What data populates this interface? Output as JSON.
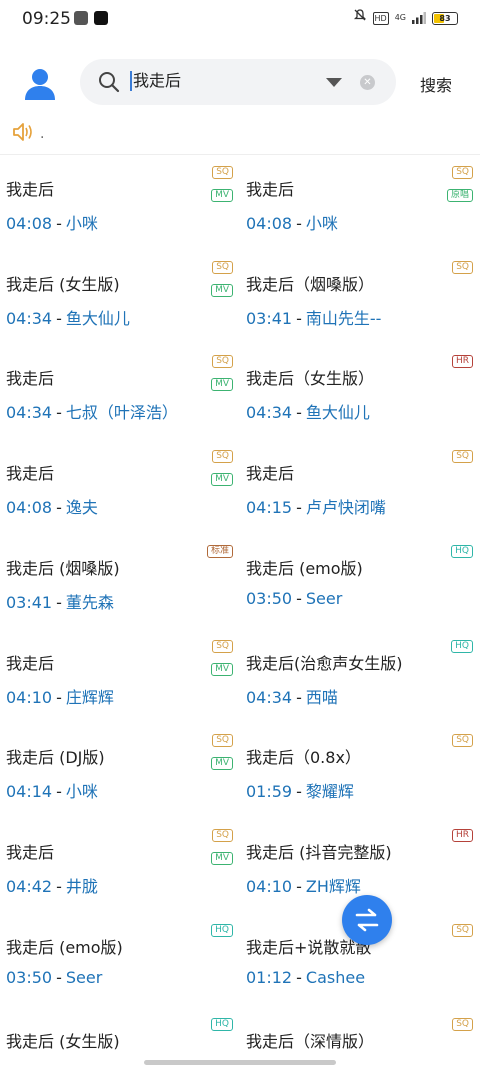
{
  "status_bar": {
    "time": "09:25",
    "network": "4G",
    "hd": "HD",
    "battery": "83"
  },
  "search": {
    "query": "我走后",
    "button_label": "搜索"
  },
  "announcement": {
    "text": "."
  },
  "colors": {
    "accent": "#2f80ed",
    "link": "#1f73b7",
    "badge_sq": "#d4a14a",
    "badge_mv": "#3cb371",
    "badge_hq": "#2fb6a8",
    "badge_hr": "#b5423a",
    "badge_std": "#b06a3a"
  },
  "songs": [
    {
      "title": "我走后",
      "time": "04:08",
      "artist": "小咪",
      "badges": [
        "SQ",
        "MV"
      ]
    },
    {
      "title": "我走后",
      "time": "04:08",
      "artist": "小咪",
      "badges": [
        "SQ",
        "原唱"
      ]
    },
    {
      "title": "我走后 (女生版)",
      "time": "04:34",
      "artist": "鱼大仙儿",
      "badges": [
        "SQ",
        "MV"
      ]
    },
    {
      "title": "我走后（烟嗓版）",
      "time": "03:41",
      "artist": "南山先生--",
      "badges": [
        "SQ"
      ]
    },
    {
      "title": "我走后",
      "time": "04:34",
      "artist": "七叔（叶泽浩）",
      "badges": [
        "SQ",
        "MV"
      ]
    },
    {
      "title": "我走后（女生版）",
      "time": "04:34",
      "artist": "鱼大仙儿",
      "badges": [
        "HR"
      ]
    },
    {
      "title": "我走后",
      "time": "04:08",
      "artist": "逸夫",
      "badges": [
        "SQ",
        "MV"
      ]
    },
    {
      "title": "我走后",
      "time": "04:15",
      "artist": "卢卢快闭嘴",
      "badges": [
        "SQ"
      ]
    },
    {
      "title": "我走后 (烟嗓版)",
      "time": "03:41",
      "artist": "董先森",
      "badges": [
        "标准"
      ]
    },
    {
      "title": "我走后 (emo版)",
      "time": "03:50",
      "artist": "Seer",
      "badges": [
        "HQ"
      ]
    },
    {
      "title": "我走后",
      "time": "04:10",
      "artist": "庄辉辉",
      "badges": [
        "SQ",
        "MV"
      ]
    },
    {
      "title": "我走后(治愈声女生版)",
      "time": "04:34",
      "artist": "西喵",
      "badges": [
        "HQ"
      ]
    },
    {
      "title": "我走后 (DJ版)",
      "time": "04:14",
      "artist": "小咪",
      "badges": [
        "SQ",
        "MV"
      ]
    },
    {
      "title": "我走后（0.8x）",
      "time": "01:59",
      "artist": "黎耀辉",
      "badges": [
        "SQ"
      ]
    },
    {
      "title": "我走后",
      "time": "04:42",
      "artist": "井胧",
      "badges": [
        "SQ",
        "MV"
      ]
    },
    {
      "title": "我走后 (抖音完整版)",
      "time": "04:10",
      "artist": "ZH辉辉",
      "badges": [
        "HR"
      ]
    },
    {
      "title": "我走后 (emo版)",
      "time": "03:50",
      "artist": "Seer",
      "badges": [
        "HQ"
      ]
    },
    {
      "title": "我走后+说散就散",
      "time": "01:12",
      "artist": "Cashee",
      "badges": [
        "SQ"
      ]
    },
    {
      "title": "我走后 (女生版)",
      "time": "",
      "artist": "",
      "badges": [
        "HQ"
      ]
    },
    {
      "title": "我走后（深情版）",
      "time": "",
      "artist": "",
      "badges": [
        "SQ"
      ]
    }
  ]
}
